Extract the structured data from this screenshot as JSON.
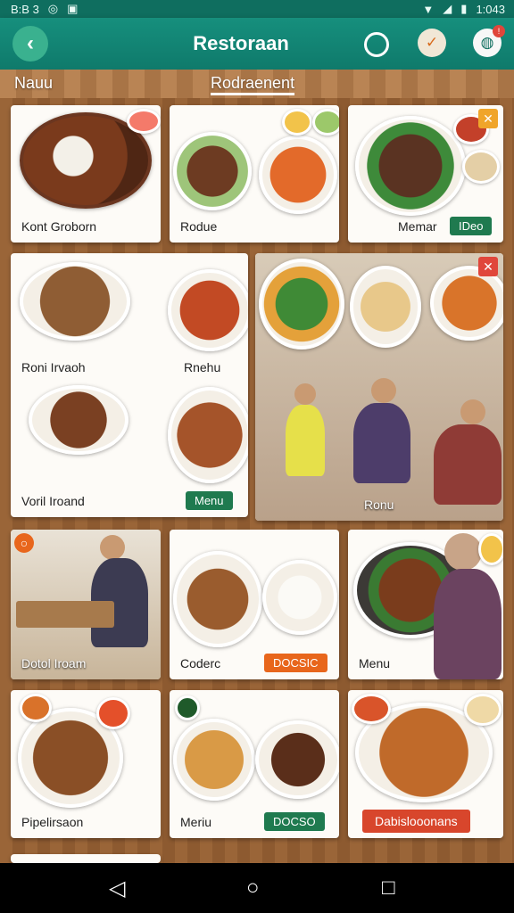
{
  "status": {
    "time": "1:043",
    "left_text": "B:B 3"
  },
  "appbar": {
    "title": "Restoraan"
  },
  "tabs": [
    {
      "label": "Nauu"
    },
    {
      "label": "Rodraenent"
    }
  ],
  "cards": [
    {
      "label": "Kont Groborn"
    },
    {
      "label": "Rodue"
    },
    {
      "label": "Memar",
      "button": "IDeo"
    },
    {
      "label": "Roni Irvaoh"
    },
    {
      "label": "Rnehu"
    },
    {
      "label": "Voril Iroand",
      "button": "Menu"
    },
    {
      "label": "Ronu"
    },
    {
      "label": "Dotol Iroam"
    },
    {
      "label": "Coderc",
      "button": "DOCSIC"
    },
    {
      "label": "Menu"
    },
    {
      "label": "Pipelirsaon"
    },
    {
      "label": "Meriu",
      "button": "DOCSO"
    },
    {
      "label": "Dabislooonans"
    }
  ],
  "icons": {
    "back": "back-arrow-icon",
    "search": "circle-icon",
    "check": "check-badge-icon",
    "globe": "globe-icon",
    "close": "close-icon"
  },
  "colors": {
    "primary": "#0f7a6b",
    "accent_green": "#1f7a4f",
    "accent_orange": "#e8661c",
    "accent_red": "#d8462c"
  }
}
